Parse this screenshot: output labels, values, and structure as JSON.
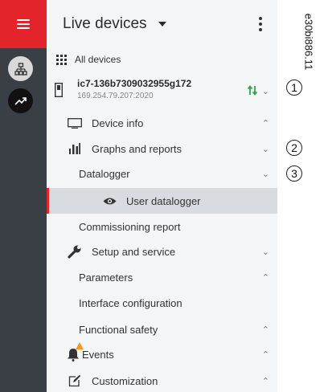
{
  "header": {
    "title": "Live devices"
  },
  "all_devices": {
    "label": "All devices"
  },
  "device": {
    "name": "ic7-136b7309032955g172",
    "ip": "169.254.79.207:2020"
  },
  "menu": {
    "device_info": "Device info",
    "graphs": "Graphs and reports",
    "datalogger": "Datalogger",
    "user_datalogger": "User datalogger",
    "commissioning": "Commissioning report",
    "setup": "Setup and service",
    "parameters": "Parameters",
    "interface": "Interface configuration",
    "functional_safety": "Functional safety",
    "events": "Events",
    "customization": "Customization"
  },
  "callouts": [
    "1",
    "2",
    "3"
  ],
  "figure_id": "e30bi886.11",
  "colors": {
    "accent": "#e3242b",
    "sync": "#2ea84a",
    "warning": "#f39a1e"
  }
}
